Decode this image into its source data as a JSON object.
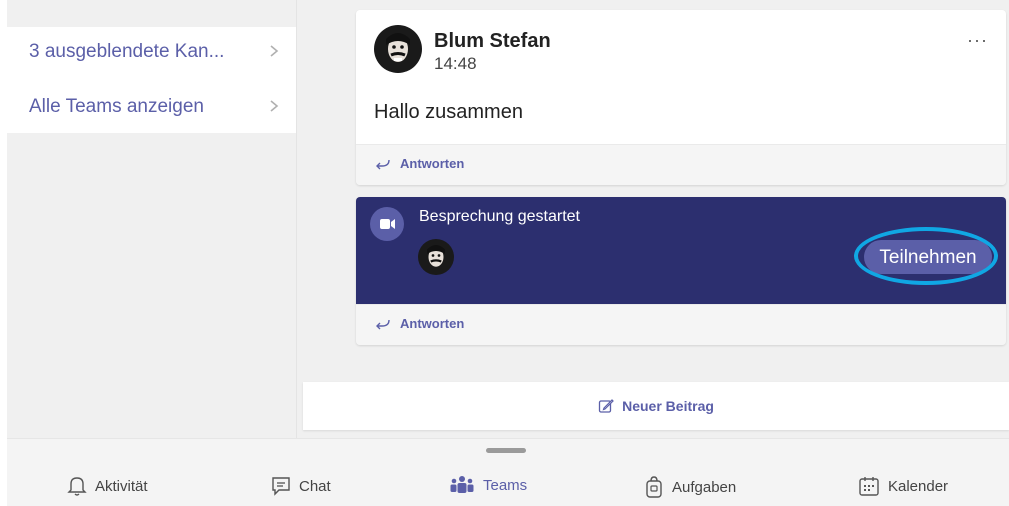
{
  "sidebar": {
    "items": [
      {
        "label": "3 ausgeblendete Kan..."
      },
      {
        "label": "Alle Teams anzeigen"
      }
    ]
  },
  "post": {
    "author": "Blum Stefan",
    "time": "14:48",
    "message": "Hallo zusammen",
    "more_label": "···",
    "reply_label": "Antworten"
  },
  "meeting": {
    "title": "Besprechung gestartet",
    "join_label": "Teilnehmen",
    "reply_label": "Antworten"
  },
  "new_post": {
    "label": "Neuer Beitrag"
  },
  "nav": {
    "items": [
      {
        "label": "Aktivität",
        "icon": "bell-icon"
      },
      {
        "label": "Chat",
        "icon": "chat-icon"
      },
      {
        "label": "Teams",
        "icon": "teams-icon",
        "active": true
      },
      {
        "label": "Aufgaben",
        "icon": "bag-icon"
      },
      {
        "label": "Kalender",
        "icon": "calendar-icon"
      }
    ]
  },
  "colors": {
    "accent": "#5b5fa8",
    "meeting_bg": "#2c2f6f",
    "highlight": "#10a7e4"
  }
}
